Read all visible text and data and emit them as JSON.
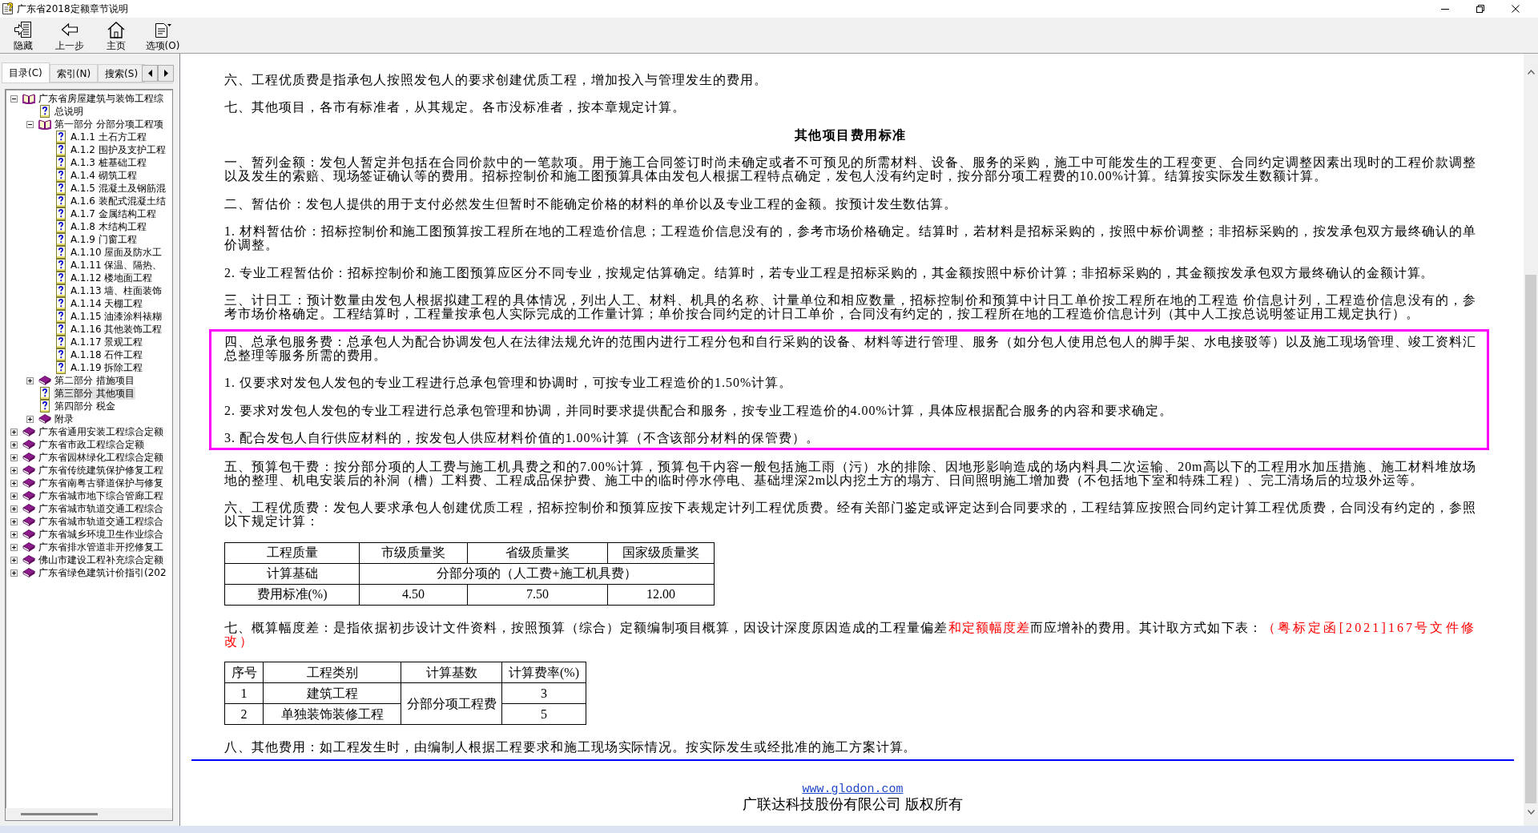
{
  "window": {
    "title": "广东省2018定额章节说明"
  },
  "toolbar": [
    {
      "kind": "hide",
      "label": "隐藏"
    },
    {
      "kind": "back",
      "label": "上一步"
    },
    {
      "kind": "home",
      "label": "主页"
    },
    {
      "kind": "options",
      "label": "选项(O)"
    }
  ],
  "nav_tabs": [
    {
      "label": "目录(C)",
      "selected": true
    },
    {
      "label": "索引(N)",
      "selected": false
    },
    {
      "label": "搜索(S)",
      "selected": false
    }
  ],
  "tree": [
    {
      "label": "广东省房屋建筑与装饰工程综",
      "kind": "book",
      "expanded": true,
      "selected": false,
      "children": [
        {
          "label": "总说明",
          "kind": "page",
          "selected": false
        },
        {
          "label": "第一部分 分部分项工程项",
          "kind": "book",
          "expanded": true,
          "selected": false,
          "children": [
            {
              "label": "A.1.1 土石方工程",
              "kind": "page",
              "selected": false
            },
            {
              "label": "A.1.2 围护及支护工程",
              "kind": "page",
              "selected": false
            },
            {
              "label": "A.1.3 桩基础工程",
              "kind": "page",
              "selected": false
            },
            {
              "label": "A.1.4 砌筑工程",
              "kind": "page",
              "selected": false
            },
            {
              "label": "A.1.5 混凝土及钢筋混",
              "kind": "page",
              "selected": false
            },
            {
              "label": "A.1.6 装配式混凝土结",
              "kind": "page",
              "selected": false
            },
            {
              "label": "A.1.7 金属结构工程",
              "kind": "page",
              "selected": false
            },
            {
              "label": "A.1.8 木结构工程",
              "kind": "page",
              "selected": false
            },
            {
              "label": "A.1.9 门窗工程",
              "kind": "page",
              "selected": false
            },
            {
              "label": "A.1.10 屋面及防水工",
              "kind": "page",
              "selected": false
            },
            {
              "label": "A.1.11 保温、隔热、",
              "kind": "page",
              "selected": false
            },
            {
              "label": "A.1.12 楼地面工程",
              "kind": "page",
              "selected": false
            },
            {
              "label": "A.1.13 墙、柱面装饰",
              "kind": "page",
              "selected": false
            },
            {
              "label": "A.1.14 天棚工程",
              "kind": "page",
              "selected": false
            },
            {
              "label": "A.1.15 油漆涂料裱糊",
              "kind": "page",
              "selected": false
            },
            {
              "label": "A.1.16 其他装饰工程",
              "kind": "page",
              "selected": false
            },
            {
              "label": "A.1.17 景观工程",
              "kind": "page",
              "selected": false
            },
            {
              "label": "A.1.18 石件工程",
              "kind": "page",
              "selected": false
            },
            {
              "label": "A.1.19 拆除工程",
              "kind": "page",
              "selected": false
            }
          ]
        },
        {
          "label": "第二部分 措施项目",
          "kind": "book",
          "expanded": false,
          "selected": false
        },
        {
          "label": "第三部分 其他项目",
          "kind": "page",
          "selected": true
        },
        {
          "label": "第四部分 税金",
          "kind": "page",
          "selected": false
        },
        {
          "label": "附录",
          "kind": "book",
          "expanded": false,
          "selected": false
        }
      ]
    },
    {
      "label": "广东省通用安装工程综合定额",
      "kind": "book",
      "expanded": false,
      "selected": false
    },
    {
      "label": "广东省市政工程综合定额",
      "kind": "book",
      "expanded": false,
      "selected": false
    },
    {
      "label": "广东省园林绿化工程综合定额",
      "kind": "book",
      "expanded": false,
      "selected": false
    },
    {
      "label": "广东省传统建筑保护修复工程",
      "kind": "book",
      "expanded": false,
      "selected": false
    },
    {
      "label": "广东省南粤古驿道保护与修复",
      "kind": "book",
      "expanded": false,
      "selected": false
    },
    {
      "label": "广东省城市地下综合管廊工程",
      "kind": "book",
      "expanded": false,
      "selected": false
    },
    {
      "label": "广东省城市轨道交通工程综合",
      "kind": "book",
      "expanded": false,
      "selected": false
    },
    {
      "label": "广东省城市轨道交通工程综合",
      "kind": "book",
      "expanded": false,
      "selected": false
    },
    {
      "label": "广东省城乡环境卫生作业综合",
      "kind": "book",
      "expanded": false,
      "selected": false
    },
    {
      "label": "广东省排水管道非开挖修复工",
      "kind": "book",
      "expanded": false,
      "selected": false
    },
    {
      "label": "佛山市建设工程补充综合定额",
      "kind": "book",
      "expanded": false,
      "selected": false
    },
    {
      "label": "广东省绿色建筑计价指引(202",
      "kind": "book",
      "expanded": false,
      "selected": false
    }
  ],
  "document": {
    "blocks": [
      {
        "kind": "paragraph",
        "text": "六、工程优质费是指承包人按照发包人的要求创建优质工程，增加投入与管理发生的费用。"
      },
      {
        "kind": "paragraph",
        "text": "七、其他项目，各市有标准者，从其规定。各市没标准者，按本章规定计算。"
      },
      {
        "kind": "heading",
        "text": "其他项目费用标准"
      },
      {
        "kind": "paragraph",
        "text": "一、暂列金额：发包人暂定并包括在合同价款中的一笔款项。用于施工合同签订时尚未确定或者不可预见的所需材料、设备、服务的采购，施工中可能发生的工程变更、合同约定调整因素出现时的工程价款调整以及发生的索赔、现场签证确认等的费用。招标控制价和施工图预算具体由发包人根据工程特点确定，发包人没有约定时，按分部分项工程费的10.00%计算。结算按实际发生数额计算。"
      },
      {
        "kind": "paragraph",
        "text": "二、暂估价：发包人提供的用于支付必然发生但暂时不能确定价格的材料的单价以及专业工程的金额。按预计发生数估算。"
      },
      {
        "kind": "paragraph",
        "text": "1. 材料暂估价：招标控制价和施工图预算按工程所在地的工程造价信息；工程造价信息没有的，参考市场价格确定。结算时，若材料是招标采购的，按照中标价调整；非招标采购的，按发承包双方最终确认的单价调整。"
      },
      {
        "kind": "paragraph",
        "text": "2. 专业工程暂估价：招标控制价和施工图预算应区分不同专业，按规定估算确定。结算时，若专业工程是招标采购的，其金额按照中标价计算；非招标采购的，其金额按发承包双方最终确认的金额计算。"
      },
      {
        "kind": "paragraph",
        "text": "三、计日工：预计数量由发包人根据拟建工程的具体情况，列出人工、材料、机具的名称、计量单位和相应数量，招标控制价和预算中计日工单价按工程所在地的工程造 价信息计列，工程造价信息没有的，参考市场价格确定。工程结算时，工程量按承包人实际完成的工作量计算；单价按合同约定的计日工单价，合同没有约定的，按工程所在地的工程造价信息计列（其中人工按总说明签证用工规定执行）。"
      },
      {
        "kind": "framed",
        "blocks": [
          {
            "kind": "paragraph",
            "text": "四、总承包服务费：总承包人为配合协调发包人在法律法规允许的范围内进行工程分包和自行采购的设备、材料等进行管理、服务（如分包人使用总包人的脚手架、水电接驳等）以及施工现场管理、竣工资料汇总整理等服务所需的费用。"
          },
          {
            "kind": "paragraph",
            "text": "1. 仅要求对发包人发包的专业工程进行总承包管理和协调时，可按专业工程造价的1.50%计算。"
          },
          {
            "kind": "paragraph",
            "text": "2. 要求对发包人发包的专业工程进行总承包管理和协调，并同时要求提供配合和服务，按专业工程造价的4.00%计算，具体应根据配合服务的内容和要求确定。"
          },
          {
            "kind": "paragraph",
            "text": "3. 配合发包人自行供应材料的，按发包人供应材料价值的1.00%计算（不含该部分材料的保管费）。"
          }
        ]
      },
      {
        "kind": "paragraph",
        "text": "五、预算包干费：按分部分项的人工费与施工机具费之和的7.00%计算，预算包干内容一般包括施工雨（污）水的排除、因地形影响造成的场内料具二次运输、20m高以下的工程用水加压措施、施工材料堆放场地的整理、机电安装后的补洞（槽）工料费、工程成品保护费、施工中的临时停水停电、基础埋深2m以内挖土方的塌方、日间照明施工增加费（不包括地下室和特殊工程）、完工清场后的垃圾外运等。"
      },
      {
        "kind": "paragraph",
        "text": "六、工程优质费：发包人要求承包人创建优质工程，招标控制价和预算应按下表规定计列工程优质费。经有关部门鉴定或评定达到合同要求的，工程结算应按照合同约定计算工程优质费，合同没有约定的，参照以下规定计算："
      },
      {
        "kind": "table",
        "columns": [
          "工程质量",
          "市级质量奖",
          "省级质量奖",
          "国家级质量奖"
        ],
        "rows": [
          [
            {
              "text": "计算基础"
            },
            {
              "text": "分部分项的（人工费+施工机具费）",
              "colspan": 3
            }
          ],
          [
            {
              "text": "费用标准(%)"
            },
            {
              "text": "4.50"
            },
            {
              "text": "7.50"
            },
            {
              "text": "12.00"
            }
          ]
        ]
      },
      {
        "kind": "segmented",
        "segments": [
          {
            "text": "七、概算幅度差：是指依据初步设计文件资料，按照预算（综合）定额编制项目概算，因设计深度原因造成的工程量偏差",
            "kind": "plain",
            "highlighted": false
          },
          {
            "text": "和定额幅度差",
            "kind": "plain",
            "highlighted": true
          },
          {
            "text": "而应增补的费用。其计取方式如下表：",
            "kind": "plain",
            "highlighted": false
          },
          {
            "text": "（粤标定函[2021]167号文件修改）",
            "kind": "citation",
            "highlighted": true
          }
        ]
      },
      {
        "kind": "table",
        "columns": [
          "序号",
          "工程类别",
          "计算基数",
          "计算费率(%)"
        ],
        "rows": [
          [
            {
              "text": "1"
            },
            {
              "text": "建筑工程"
            },
            {
              "text": "分部分项工程费",
              "rowspan": 2
            },
            {
              "text": "3"
            }
          ],
          [
            {
              "text": "2"
            },
            {
              "text": "单独装饰装修工程"
            },
            {
              "text": "5"
            }
          ]
        ]
      },
      {
        "kind": "paragraph",
        "text": "八、其他费用：如工程发生时，由编制人根据工程要求和施工现场实际情况。按实际发生或经批准的施工方案计算。"
      }
    ]
  },
  "footer": {
    "link": "www.glodon.com",
    "copyright": "广联达科技股份有限公司 版权所有"
  }
}
